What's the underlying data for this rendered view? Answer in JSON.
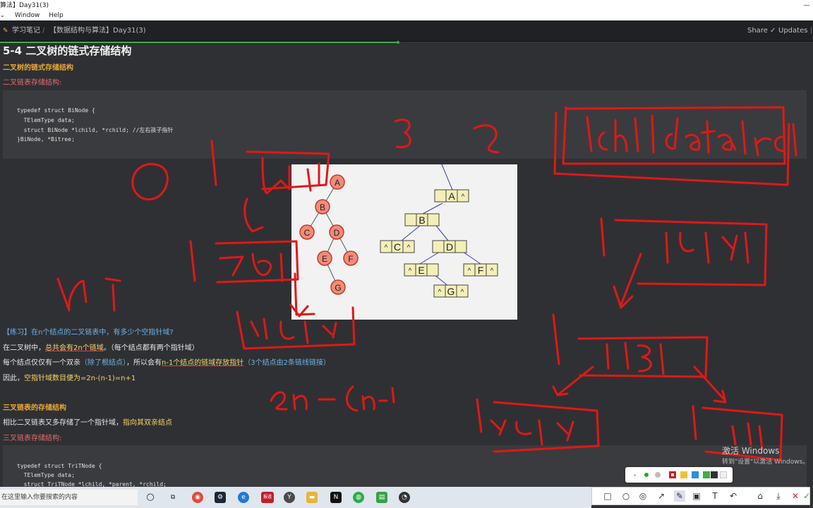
{
  "window": {
    "title": "算法】Day31(3)",
    "close_glyph": "—",
    "menu": [
      "Window",
      "Help"
    ]
  },
  "topbar": {
    "crumb_parent": "学习笔记",
    "crumb_sep": "/",
    "crumb_current": "【数据结构与算法】Day31(3)",
    "share": "Share",
    "updates": "Updates",
    "reading_progress": 0.49
  },
  "doc": {
    "title": "5-4 二叉树的链式存储结构",
    "section1_heading": "二叉树的链式存储结构",
    "section1_label": "二叉链表存储结构:",
    "code1": [
      "typedef struct BiNode {",
      "  TElemType data;",
      "  struct BiNode *lchild, *rchild; //左右孩子指针",
      "}BiNode, *Bitree;"
    ],
    "exercise": "【练习】在n个结点的二叉链表中，有多少个空指针域?",
    "p1_a": "在二叉树中，",
    "p1_b": "总共会有2n个链域",
    "p1_c": "。（每个结点都有两个指针域）",
    "p2_a": "每个结点仅仅有一个双亲",
    "p2_b": "（除了根结点）",
    "p2_c": "，所以会有",
    "p2_d": "n-1个结点的链域存放指针",
    "p2_e": "（3个结点由2条链线链接）",
    "p3_a": "因此，",
    "p3_b": "空指针域数目便为=2n-(n-1)=n+1",
    "section2_heading": "三叉链表的存储结构",
    "p4_a": "相比二叉链表又多存储了一个指针域，",
    "p4_b": "指向其双亲结点",
    "section2_label": "三叉链表存储结构:",
    "code2": [
      "typedef struct TriTNode {",
      "  TElemType data;",
      "  struct TriTNode *lchild, *parent, *rchild;"
    ]
  },
  "figure": {
    "tree_nodes": [
      "A",
      "B",
      "C",
      "D",
      "E",
      "F",
      "G"
    ],
    "null_mark": "^"
  },
  "watermark": {
    "line1": "激活 Windows",
    "line2": "转到\"设置\"以激活 Windows。"
  },
  "taskbar": {
    "search_placeholder": "在这里输入你要搜索的内容",
    "app_label": "报道"
  },
  "colors": {
    "ink_red": "#e01818",
    "accent_green": "#3fae4f",
    "heading_orange": "#e8a838",
    "label_red": "#e46c6c"
  }
}
